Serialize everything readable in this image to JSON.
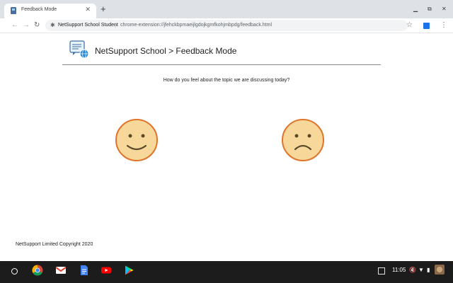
{
  "tab": {
    "title": "Feedback Mode",
    "close_glyph": "✕"
  },
  "new_tab_glyph": "+",
  "window_controls": {
    "minimize": "▁",
    "restore": "⧉",
    "close": "✕"
  },
  "toolbar": {
    "back_glyph": "←",
    "forward_glyph": "→",
    "reload_glyph": "↻",
    "site_name": "NetSupport School Student",
    "separator": "|",
    "url": "chrome-extension://jfehckbpmaeijlgdojkgmfkohjmbpdg/feedback.html",
    "star_glyph": "☆",
    "menu_glyph": "⋮"
  },
  "page": {
    "app_title": "NetSupport School > Feedback Mode",
    "question": "How do you feel about the topic we are discussing today?",
    "copyright": "NetSupport Limited Copyright 2020",
    "faces": [
      {
        "mood": "happy",
        "icon": "happy-face-icon"
      },
      {
        "mood": "sad",
        "icon": "sad-face-icon"
      }
    ]
  },
  "shelf": {
    "apps": [
      "chrome-icon",
      "gmail-icon",
      "docs-icon",
      "youtube-icon",
      "play-store-icon"
    ],
    "time": "11:05",
    "mute_glyph": "🔇",
    "wifi_glyph": "▼",
    "battery_glyph": "▮"
  },
  "colors": {
    "face_fill": "#f7d79a",
    "face_stroke": "#e0742a",
    "face_features": "#5a4a2a",
    "shelf_bg": "#1c1c1c",
    "tabstrip_bg": "#dee1e6"
  }
}
